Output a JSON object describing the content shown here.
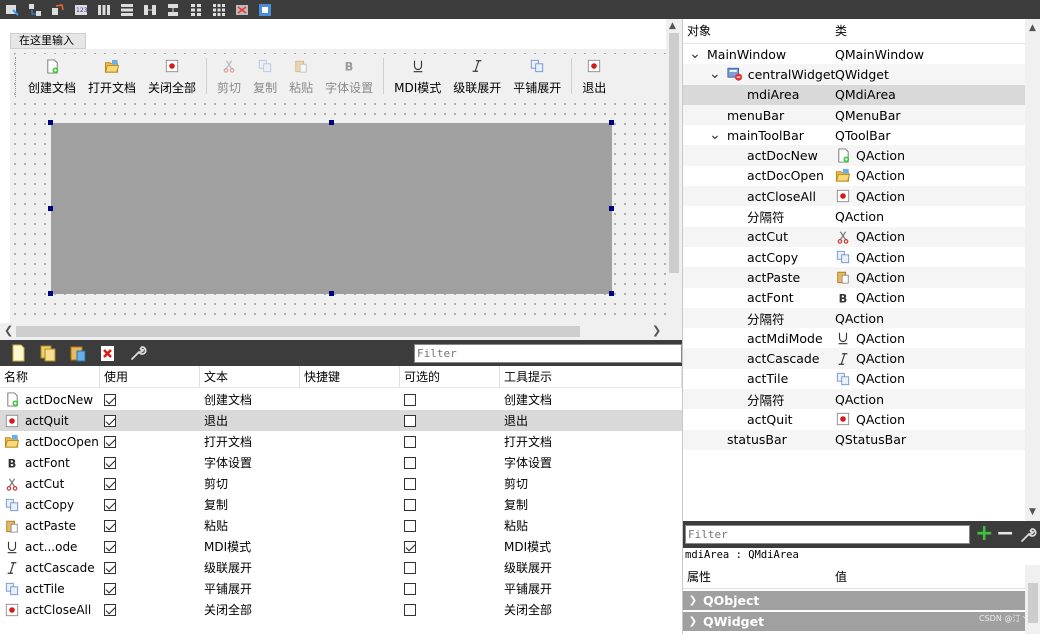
{
  "top_toolbar": {
    "icons": [
      "edit-widgets-icon",
      "edit-signals-icon",
      "edit-buddies-icon",
      "edit-tab-order-icon",
      "layout-horizontal-icon",
      "layout-vertical-icon",
      "layout-h-splitter-icon",
      "layout-v-splitter-icon",
      "layout-form-icon",
      "layout-grid-icon",
      "break-layout-icon",
      "adjust-size-icon"
    ]
  },
  "form": {
    "menu_placeholder": "在这里输入",
    "toolbar": [
      {
        "label": "创建文档",
        "icon": "new-doc-icon",
        "enabled": true
      },
      {
        "label": "打开文档",
        "icon": "open-folder-icon",
        "enabled": true
      },
      {
        "label": "关闭全部",
        "icon": "close-all-icon",
        "enabled": true
      },
      {
        "label": "剪切",
        "icon": "cut-icon",
        "enabled": false
      },
      {
        "label": "复制",
        "icon": "copy-icon",
        "enabled": false
      },
      {
        "label": "粘贴",
        "icon": "paste-icon",
        "enabled": false
      },
      {
        "label": "字体设置",
        "icon": "font-icon",
        "enabled": false
      },
      {
        "label": "MDI模式",
        "icon": "underline-icon",
        "enabled": true
      },
      {
        "label": "级联展开",
        "icon": "italic-icon",
        "enabled": true
      },
      {
        "label": "平铺展开",
        "icon": "tile-icon",
        "enabled": true
      },
      {
        "label": "退出",
        "icon": "quit-icon",
        "enabled": true
      }
    ]
  },
  "action_editor": {
    "filter_placeholder": "Filter",
    "columns": [
      "名称",
      "使用",
      "文本",
      "快捷键",
      "可选的",
      "工具提示"
    ],
    "rows": [
      {
        "name": "actDocNew",
        "icon": "new-doc-icon",
        "used": true,
        "text": "创建文档",
        "shortcut": "",
        "checkable": false,
        "tooltip": "创建文档"
      },
      {
        "name": "actQuit",
        "icon": "quit-icon",
        "used": true,
        "text": "退出",
        "shortcut": "",
        "checkable": false,
        "tooltip": "退出",
        "selected": true
      },
      {
        "name": "actDocOpen",
        "icon": "open-folder-icon",
        "used": true,
        "text": "打开文档",
        "shortcut": "",
        "checkable": false,
        "tooltip": "打开文档"
      },
      {
        "name": "actFont",
        "icon": "font-icon",
        "used": true,
        "text": "字体设置",
        "shortcut": "",
        "checkable": false,
        "tooltip": "字体设置"
      },
      {
        "name": "actCut",
        "icon": "cut-icon",
        "used": true,
        "text": "剪切",
        "shortcut": "",
        "checkable": false,
        "tooltip": "剪切"
      },
      {
        "name": "actCopy",
        "icon": "copy-icon",
        "used": true,
        "text": "复制",
        "shortcut": "",
        "checkable": false,
        "tooltip": "复制"
      },
      {
        "name": "actPaste",
        "icon": "paste-icon",
        "used": true,
        "text": "粘贴",
        "shortcut": "",
        "checkable": false,
        "tooltip": "粘贴"
      },
      {
        "name": "act...ode",
        "icon": "underline-icon",
        "used": true,
        "text": "MDI模式",
        "shortcut": "",
        "checkable": true,
        "tooltip": "MDI模式"
      },
      {
        "name": "actCascade",
        "icon": "italic-icon",
        "used": true,
        "text": "级联展开",
        "shortcut": "",
        "checkable": false,
        "tooltip": "级联展开"
      },
      {
        "name": "actTile",
        "icon": "tile-icon",
        "used": true,
        "text": "平铺展开",
        "shortcut": "",
        "checkable": false,
        "tooltip": "平铺展开"
      },
      {
        "name": "actCloseAll",
        "icon": "close-all-icon",
        "used": true,
        "text": "关闭全部",
        "shortcut": "",
        "checkable": false,
        "tooltip": "关闭全部"
      }
    ]
  },
  "object_inspector": {
    "columns": [
      "对象",
      "类"
    ],
    "rows": [
      {
        "level": 0,
        "expand": "open",
        "name": "MainWindow",
        "class": "QMainWindow"
      },
      {
        "level": 1,
        "expand": "open",
        "name": "centralWidget",
        "class": "QWidget",
        "icon": "central-widget-icon"
      },
      {
        "level": 2,
        "expand": "",
        "name": "mdiArea",
        "class": "QMdiArea",
        "selected": true
      },
      {
        "level": 1,
        "expand": "",
        "name": "menuBar",
        "class": "QMenuBar"
      },
      {
        "level": 1,
        "expand": "open",
        "name": "mainToolBar",
        "class": "QToolBar"
      },
      {
        "level": 2,
        "expand": "",
        "name": "actDocNew",
        "class": "QAction",
        "class_icon": "new-doc-icon"
      },
      {
        "level": 2,
        "expand": "",
        "name": "actDocOpen",
        "class": "QAction",
        "class_icon": "open-folder-icon"
      },
      {
        "level": 2,
        "expand": "",
        "name": "actCloseAll",
        "class": "QAction",
        "class_icon": "close-all-icon"
      },
      {
        "level": 2,
        "expand": "",
        "name": "分隔符",
        "class": "QAction"
      },
      {
        "level": 2,
        "expand": "",
        "name": "actCut",
        "class": "QAction",
        "class_icon": "cut-icon"
      },
      {
        "level": 2,
        "expand": "",
        "name": "actCopy",
        "class": "QAction",
        "class_icon": "copy-icon"
      },
      {
        "level": 2,
        "expand": "",
        "name": "actPaste",
        "class": "QAction",
        "class_icon": "paste-icon"
      },
      {
        "level": 2,
        "expand": "",
        "name": "actFont",
        "class": "QAction",
        "class_icon": "font-icon"
      },
      {
        "level": 2,
        "expand": "",
        "name": "分隔符",
        "class": "QAction"
      },
      {
        "level": 2,
        "expand": "",
        "name": "actMdiMode",
        "class": "QAction",
        "class_icon": "underline-icon"
      },
      {
        "level": 2,
        "expand": "",
        "name": "actCascade",
        "class": "QAction",
        "class_icon": "italic-icon"
      },
      {
        "level": 2,
        "expand": "",
        "name": "actTile",
        "class": "QAction",
        "class_icon": "tile-icon"
      },
      {
        "level": 2,
        "expand": "",
        "name": "分隔符",
        "class": "QAction"
      },
      {
        "level": 2,
        "expand": "",
        "name": "actQuit",
        "class": "QAction",
        "class_icon": "quit-icon"
      },
      {
        "level": 1,
        "expand": "",
        "name": "statusBar",
        "class": "QStatusBar"
      }
    ]
  },
  "property_editor": {
    "filter_placeholder": "Filter",
    "object_label": "mdiArea : QMdiArea",
    "columns": [
      "属性",
      "值"
    ],
    "groups": [
      "QObject",
      "QWidget"
    ]
  },
  "watermark": "CSDN @汀丶",
  "colors": {
    "mdi_area": "#a0a0a0",
    "selection": "#d9d9d9",
    "handle": "#000080",
    "dark_toolbar": "#3c3c3c",
    "add_green": "#3ec13e"
  }
}
